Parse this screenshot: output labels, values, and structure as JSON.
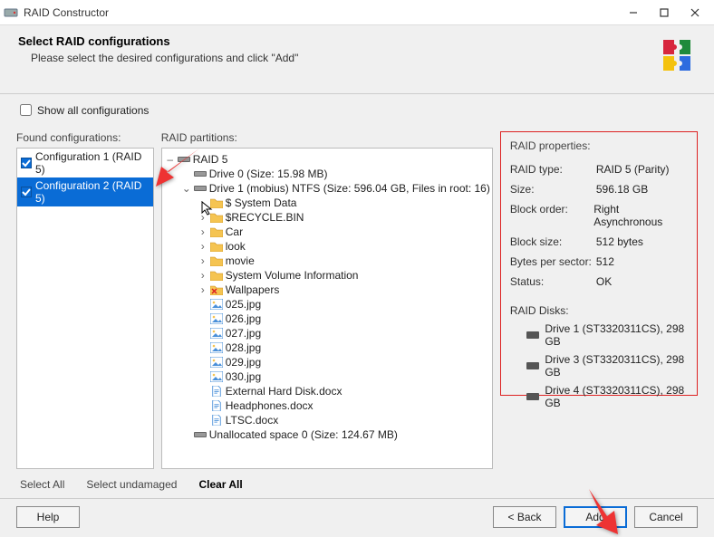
{
  "window": {
    "title": "RAID Constructor"
  },
  "header": {
    "title": "Select RAID configurations",
    "subtitle": "Please select the desired configurations and click \"Add\""
  },
  "show_all": {
    "label": "Show all configurations",
    "checked": false
  },
  "labels": {
    "found": "Found configurations:",
    "partitions": "RAID partitions:",
    "properties": "RAID properties:"
  },
  "configs": [
    {
      "label": "Configuration 1 (RAID 5)",
      "checked": true,
      "selected": false
    },
    {
      "label": "Configuration 2 (RAID 5)",
      "checked": true,
      "selected": true
    }
  ],
  "tree": [
    {
      "depth": 0,
      "tog": "-",
      "icon": "disk",
      "label": "RAID 5"
    },
    {
      "depth": 1,
      "tog": "",
      "icon": "disk",
      "label": "Drive 0 (Size: 15.98 MB)"
    },
    {
      "depth": 1,
      "tog": "v",
      "icon": "disk",
      "label": "Drive 1 (mobius) NTFS (Size: 596.04 GB, Files in root: 16)"
    },
    {
      "depth": 2,
      "tog": ">",
      "icon": "folder",
      "label": "$ System Data"
    },
    {
      "depth": 2,
      "tog": ">",
      "icon": "folder",
      "label": "$RECYCLE.BIN"
    },
    {
      "depth": 2,
      "tog": ">",
      "icon": "folder",
      "label": "Car"
    },
    {
      "depth": 2,
      "tog": ">",
      "icon": "folder",
      "label": "look"
    },
    {
      "depth": 2,
      "tog": ">",
      "icon": "folder",
      "label": "movie"
    },
    {
      "depth": 2,
      "tog": ">",
      "icon": "folder",
      "label": "System Volume Information"
    },
    {
      "depth": 2,
      "tog": ">",
      "icon": "folder-x",
      "label": "Wallpapers"
    },
    {
      "depth": 2,
      "tog": "",
      "icon": "image",
      "label": "025.jpg"
    },
    {
      "depth": 2,
      "tog": "",
      "icon": "image",
      "label": "026.jpg"
    },
    {
      "depth": 2,
      "tog": "",
      "icon": "image",
      "label": "027.jpg"
    },
    {
      "depth": 2,
      "tog": "",
      "icon": "image",
      "label": "028.jpg"
    },
    {
      "depth": 2,
      "tog": "",
      "icon": "image",
      "label": "029.jpg"
    },
    {
      "depth": 2,
      "tog": "",
      "icon": "image",
      "label": "030.jpg"
    },
    {
      "depth": 2,
      "tog": "",
      "icon": "doc",
      "label": "External Hard Disk.docx"
    },
    {
      "depth": 2,
      "tog": "",
      "icon": "doc",
      "label": "Headphones.docx"
    },
    {
      "depth": 2,
      "tog": "",
      "icon": "doc",
      "label": "LTSC.docx"
    },
    {
      "depth": 1,
      "tog": "",
      "icon": "disk",
      "label": "Unallocated space 0 (Size: 124.67 MB)"
    }
  ],
  "properties": [
    {
      "k": "RAID type:",
      "v": "RAID 5 (Parity)"
    },
    {
      "k": "Size:",
      "v": "596.18 GB"
    },
    {
      "k": "Block order:",
      "v": "Right Asynchronous"
    },
    {
      "k": "Block size:",
      "v": "512 bytes"
    },
    {
      "k": "Bytes per sector:",
      "v": "512"
    },
    {
      "k": "Status:",
      "v": "OK"
    }
  ],
  "disks_title": "RAID Disks:",
  "disks": [
    "Drive 1 (ST3320311CS), 298 GB",
    "Drive 3 (ST3320311CS), 298 GB",
    "Drive 4 (ST3320311CS), 298 GB"
  ],
  "linkbar": {
    "select_all": "Select All",
    "select_undamaged": "Select undamaged",
    "clear_all": "Clear All"
  },
  "footer": {
    "help": "Help",
    "back": "< Back",
    "add": "Add",
    "cancel": "Cancel"
  }
}
